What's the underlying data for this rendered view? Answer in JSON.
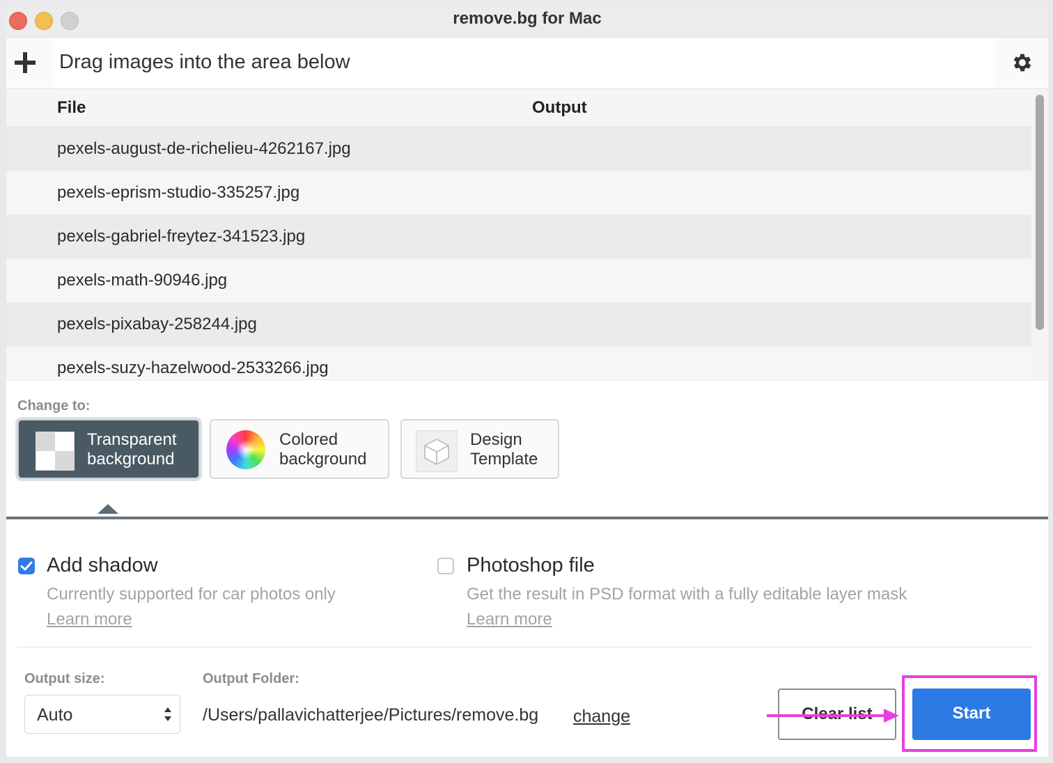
{
  "window": {
    "title": "remove.bg for Mac"
  },
  "dropbar": {
    "add_icon": "plus-icon",
    "prompt": "Drag images into the area below",
    "settings_icon": "gear-icon"
  },
  "table": {
    "columns": [
      "File",
      "Output"
    ],
    "rows": [
      {
        "file": "pexels-august-de-richelieu-4262167.jpg",
        "output": ""
      },
      {
        "file": "pexels-eprism-studio-335257.jpg",
        "output": ""
      },
      {
        "file": "pexels-gabriel-freytez-341523.jpg",
        "output": ""
      },
      {
        "file": "pexels-math-90946.jpg",
        "output": ""
      },
      {
        "file": "pexels-pixabay-258244.jpg",
        "output": ""
      },
      {
        "file": "pexels-suzy-hazelwood-2533266.jpg",
        "output": ""
      }
    ]
  },
  "change_to": {
    "label": "Change to:",
    "options": [
      {
        "line1": "Transparent",
        "line2": "background",
        "icon": "checkerboard-icon",
        "selected": true
      },
      {
        "line1": "Colored",
        "line2": "background",
        "icon": "color-wheel-icon",
        "selected": false
      },
      {
        "line1": "Design",
        "line2": "Template",
        "icon": "cube-icon",
        "selected": false
      }
    ]
  },
  "options": {
    "shadow": {
      "title": "Add shadow",
      "checked": true,
      "description": "Currently supported for car photos only",
      "link": "Learn more"
    },
    "photoshop": {
      "title": "Photoshop file",
      "checked": false,
      "description": "Get the result in PSD format with a fully editable layer mask",
      "link": "Learn more"
    }
  },
  "footer": {
    "output_size_label": "Output size:",
    "output_size_value": "Auto",
    "output_folder_label": "Output Folder:",
    "output_folder_path": "/Users/pallavichatterjee/Pictures/remove.bg",
    "change_link": "change",
    "clear_label": "Clear list",
    "start_label": "Start"
  },
  "colors": {
    "accent": "#2c7be5",
    "checkbox": "#2f7be9",
    "selected_option": "#4a5a64",
    "annotation": "#e83fe0"
  }
}
